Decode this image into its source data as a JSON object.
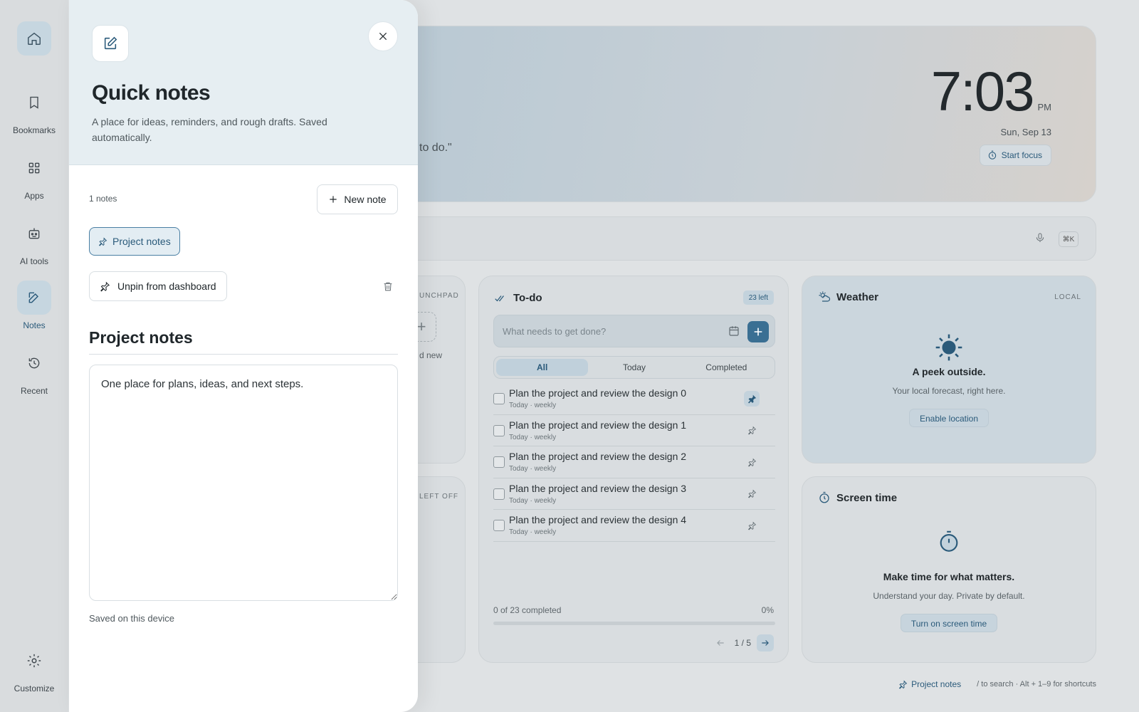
{
  "rail": {
    "items": [
      {
        "label": "",
        "icon": "home-icon"
      },
      {
        "label": "Bookmarks",
        "icon": "bookmark-icon"
      },
      {
        "label": "Apps",
        "icon": "apps-grid-icon"
      },
      {
        "label": "AI tools",
        "icon": "robot-icon"
      },
      {
        "label": "Notes",
        "icon": "edit-note-icon"
      },
      {
        "label": "Recent",
        "icon": "history-icon"
      }
    ],
    "customize": "Customize"
  },
  "hero": {
    "quote_fragment": "to do.\"",
    "time": "7:03",
    "ampm": "PM",
    "date": "Sun, Sep 13",
    "focus_label": "Start focus"
  },
  "search": {
    "shortcut": "⌘K"
  },
  "launchpad": {
    "label": "UNCHPAD",
    "add_new": "d new"
  },
  "left_off": {
    "label": "LEFT OFF"
  },
  "todo": {
    "title": "To-do",
    "badge": "23 left",
    "placeholder": "What needs to get done?",
    "tabs": [
      "All",
      "Today",
      "Completed"
    ],
    "items": [
      {
        "text": "Plan the project and review the design 0",
        "meta": "Today · weekly",
        "pinned": true
      },
      {
        "text": "Plan the project and review the design 1",
        "meta": "Today · weekly",
        "pinned": false
      },
      {
        "text": "Plan the project and review the design 2",
        "meta": "Today · weekly",
        "pinned": false
      },
      {
        "text": "Plan the project and review the design 3",
        "meta": "Today · weekly",
        "pinned": false
      },
      {
        "text": "Plan the project and review the design 4",
        "meta": "Today · weekly",
        "pinned": false
      }
    ],
    "progress_label": "0 of 23 completed",
    "progress_pct": "0%",
    "progress_value": 0,
    "pager": "1 / 5"
  },
  "weather": {
    "title": "Weather",
    "tag": "LOCAL",
    "headline": "A peek outside.",
    "sub": "Your local forecast, right here.",
    "button": "Enable location"
  },
  "screen_time": {
    "title": "Screen time",
    "headline": "Make time for what matters.",
    "sub": "Understand your day. Private by default.",
    "button": "Turn on screen time"
  },
  "footer": {
    "pinned": "Project notes",
    "hint": "/ to search · Alt + 1–9 for shortcuts"
  },
  "drawer": {
    "title": "Quick notes",
    "description": "A place for ideas, reminders, and rough drafts. Saved automatically.",
    "count": "1 notes",
    "new_note": "New note",
    "chip": "Project notes",
    "unpin": "Unpin from dashboard",
    "note_title": "Project notes",
    "note_body": "One place for plans, ideas, and next steps.",
    "saved": "Saved on this device"
  },
  "colors": {
    "accent": "#3a6f93",
    "accent_text": "#2a5a7a"
  }
}
